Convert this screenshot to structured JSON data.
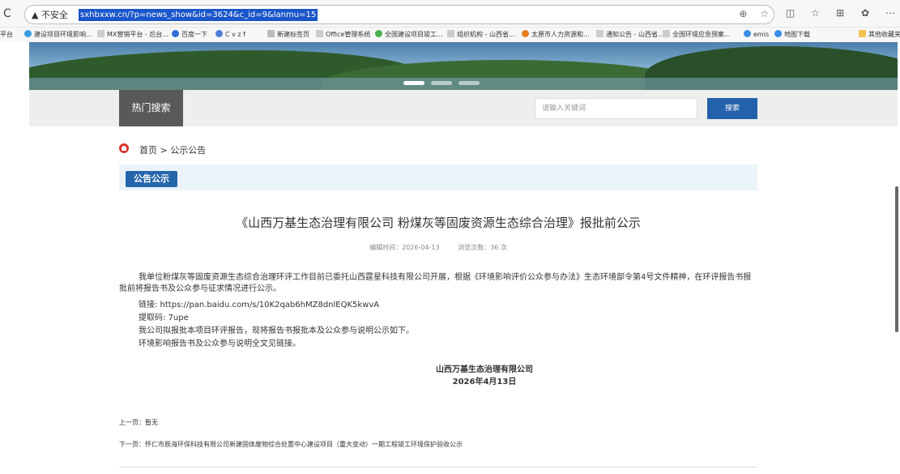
{
  "browser": {
    "security_label": "▲ 不安全",
    "url": "sxhbxxw.cn/?p=news_show&id=3624&c_id=9&lanmu=15",
    "bookmarks": [
      "平台",
      "建设项目环境影响...",
      "MX营销平台 - 后台...",
      "百度一下",
      "C v z f",
      "新建标签页",
      "Office管理系统",
      "全国建设项目竣工...",
      "组织机构 - 山西省...",
      "太原市人力资源和...",
      "通知公告 - 山西省...",
      "全国环境应急预案...",
      "emis",
      "地图下载",
      "其他收藏夹"
    ]
  },
  "header": {
    "hot_search_label": "热门搜索",
    "search_placeholder": "请输入关键词",
    "search_button": "搜索"
  },
  "breadcrumb": {
    "text": "首页 > 公示公告"
  },
  "section": {
    "tag": "公告公示"
  },
  "article": {
    "title": "《山西万基生态治理有限公司 粉煤灰等固废资源生态综合治理》报批前公示",
    "edit_time": "编辑时间：2026-04-13",
    "views": "浏览次数：36 次",
    "paragraph": "我单位粉煤灰等固废资源生态综合治理环评工作目前已委托山西霆星科技有限公司开展，根据《环境影响评价公众参与办法》生态环境部令第4号文件精神，在环评报告书报批前将报告书及公众参与征求情况进行公示。",
    "link_line": "链接: https://pan.baidu.com/s/10K2qab6hMZ8dnlEQK5kwvA",
    "code_line": "提取码: 7upe",
    "line3": "我公司拟报批本项目环评报告，现将报告书报批本及公众参与说明公示如下。",
    "line4": "环境影响报告书及公众参与说明全文见链接。",
    "sign_company": "山西万基生态治理有限公司",
    "sign_date": "2026年4月13日"
  },
  "pager": {
    "prev": "上一页：暂无",
    "next": "下一页：怀仁市辰海环保科技有限公司新建固体废物综合处置中心建设项目（重大变动）一期工程竣工环境保护验收公示"
  }
}
